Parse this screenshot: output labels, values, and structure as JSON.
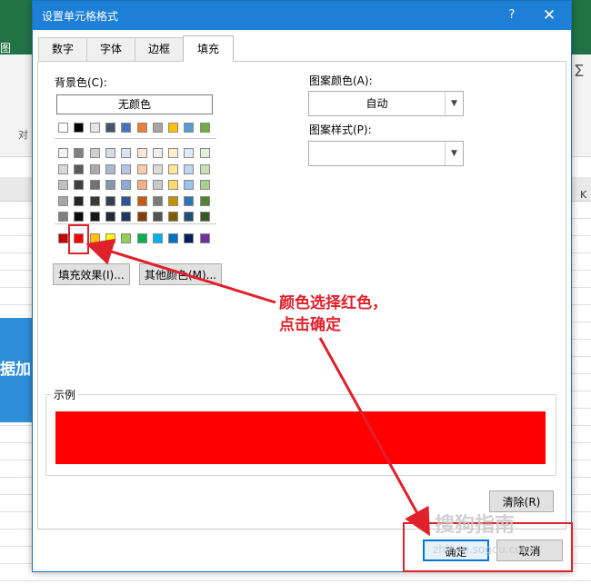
{
  "background": {
    "ribbon_left_label": "图",
    "align_label": "对",
    "column_k": "K",
    "banner_text": "据加",
    "sigma": "Σ"
  },
  "dialog": {
    "title": "设置单元格格式",
    "help": "?",
    "close": "✕",
    "tabs": [
      "数字",
      "字体",
      "边框",
      "填充"
    ],
    "active_tab": "填充",
    "background_color_label": "背景色(C):",
    "no_color_label": "无颜色",
    "pattern_color_label": "图案颜色(A):",
    "pattern_color_value": "自动",
    "pattern_style_label": "图案样式(P):",
    "pattern_style_value": "",
    "fill_effects_button": "填充效果(I)...",
    "more_colors_button": "其他颜色(M)...",
    "sample_label": "示例",
    "sample_color": "#FF0000",
    "clear_button": "清除(R)",
    "ok_button": "确定",
    "cancel_button": "取消"
  },
  "palette": {
    "top_row": [
      "#FFFFFF",
      "#000000",
      "#E7E6E6",
      "#44546A",
      "#4472C4",
      "#ED7D31",
      "#A5A5A5",
      "#FFC000",
      "#5B9BD5",
      "#70AD47"
    ],
    "shades": [
      [
        "#F2F2F2",
        "#808080",
        "#D0CECE",
        "#D6DCE4",
        "#D9E2F3",
        "#FBE5D5",
        "#EDEDED",
        "#FFF2CC",
        "#DEEBF6",
        "#E2EFD9"
      ],
      [
        "#D8D8D8",
        "#595959",
        "#AEAAAA",
        "#ACB9CA",
        "#B4C6E7",
        "#F7CBAC",
        "#DBDBDB",
        "#FEE599",
        "#BDD7EE",
        "#C5E0B3"
      ],
      [
        "#BFBFBF",
        "#3F3F3F",
        "#757070",
        "#8496B0",
        "#8EAADB",
        "#F4B183",
        "#C9C9C9",
        "#FFD965",
        "#9CC3E5",
        "#A8D08D"
      ],
      [
        "#A5A5A5",
        "#262626",
        "#3A3838",
        "#323F4F",
        "#2F5496",
        "#C55A11",
        "#7B7B7B",
        "#BF9000",
        "#2E75B5",
        "#538135"
      ],
      [
        "#7F7F7F",
        "#0C0C0C",
        "#171616",
        "#222A35",
        "#1F3864",
        "#833C0B",
        "#525252",
        "#7F6000",
        "#1E4E79",
        "#375623"
      ]
    ],
    "standard": [
      "#C00000",
      "#FF0000",
      "#FFC000",
      "#FFFF00",
      "#92D050",
      "#00B050",
      "#00B0F0",
      "#0070C0",
      "#002060",
      "#7030A0"
    ],
    "selected_index": 1
  },
  "annotation": {
    "line1": "颜色选择红色，",
    "line2": "点击确定",
    "color": "#E0202A"
  },
  "watermark": {
    "text": "搜狗指南",
    "url": "zhinan.sogou.com"
  }
}
